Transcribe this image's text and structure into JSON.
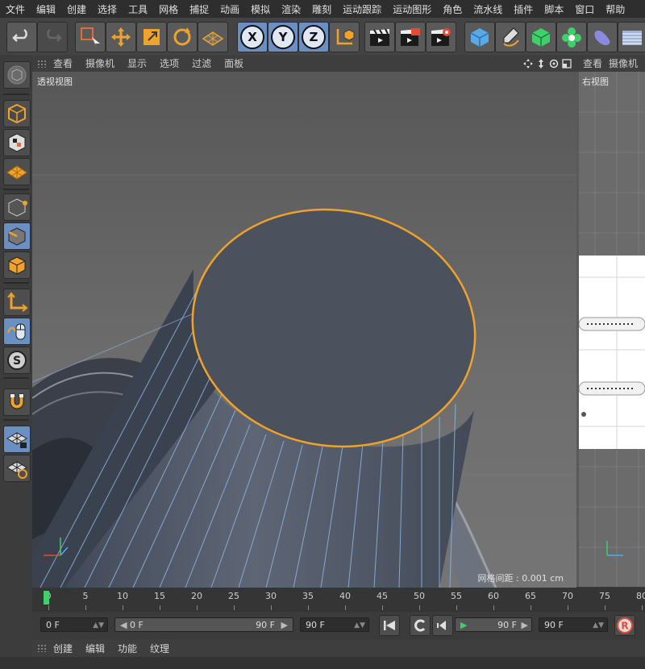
{
  "menubar": {
    "items": [
      "文件",
      "编辑",
      "创建",
      "选择",
      "工具",
      "网格",
      "捕捉",
      "动画",
      "模拟",
      "渲染",
      "雕刻",
      "运动跟踪",
      "运动图形",
      "角色",
      "流水线",
      "插件",
      "脚本",
      "窗口",
      "帮助"
    ]
  },
  "toolbar": {
    "axis_x": "X",
    "axis_y": "Y",
    "axis_z": "Z"
  },
  "viewport": {
    "menu": [
      "查看",
      "摄像机",
      "显示",
      "选项",
      "过滤",
      "面板"
    ],
    "label": "透视视图",
    "grid_info": "网格间距 : 0.001 cm"
  },
  "right_viewport": {
    "menu": [
      "查看",
      "摄像机"
    ],
    "label": "右视图"
  },
  "timeline": {
    "ticks": [
      "0",
      "5",
      "10",
      "15",
      "20",
      "25",
      "30",
      "35",
      "40",
      "45",
      "50",
      "55",
      "60",
      "65",
      "70",
      "75",
      "80"
    ],
    "current_frame": 0
  },
  "transport": {
    "start_field": "0 F",
    "range_start": "0 F",
    "range_end": "90 F",
    "end_field": "90 F",
    "preview_end": "90 F",
    "max_field": "90 F"
  },
  "bottom_panel": {
    "menu": [
      "创建",
      "编辑",
      "功能",
      "纹理"
    ]
  },
  "colors": {
    "selection": "#f0a22a",
    "accent_blue": "#6a8fc2",
    "playhead": "#3fd06a"
  }
}
